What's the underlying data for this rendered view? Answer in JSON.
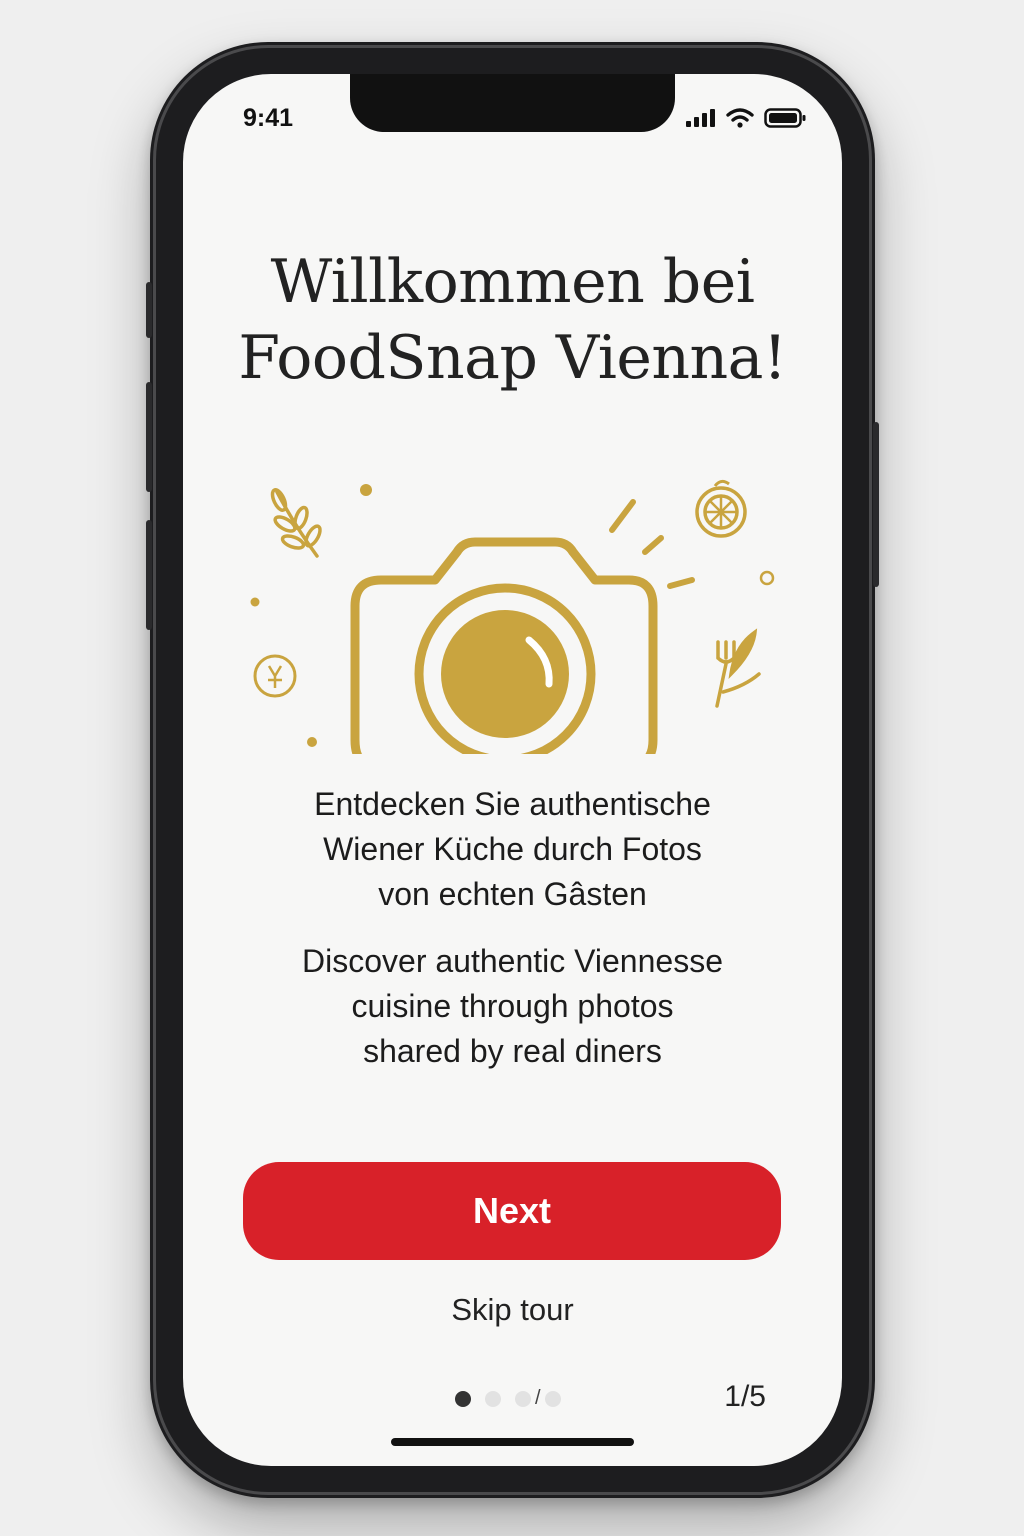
{
  "status_bar": {
    "time": "9:41",
    "icons": [
      "cellular-signal-icon",
      "wifi-icon",
      "battery-icon"
    ]
  },
  "onboarding": {
    "title_line1": "Willkommen bei",
    "title_line2": "FoodSnap Vienna!",
    "illustration_icon": "camera-icon",
    "description_de_line1": "Entdecken Sie authentische",
    "description_de_line2": "Wiener Küche durch Fotos",
    "description_de_line3": "von echten Gâsten",
    "description_en_line1": "Discover authentic Viennesse",
    "description_en_line2": "cuisine through photos",
    "description_en_line3": "shared by real diners",
    "next_label": "Next",
    "skip_label": "Skip tour",
    "pager_separator": "/",
    "page_indicator": "1/5"
  },
  "colors": {
    "accent_red": "#d82129",
    "gold": "#c9a43f",
    "background": "#f7f7f6"
  }
}
